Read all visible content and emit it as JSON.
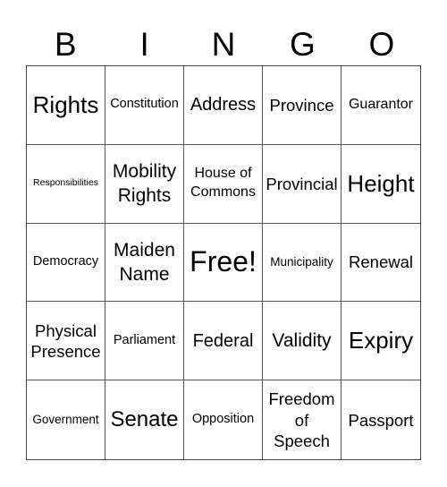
{
  "header": [
    "B",
    "I",
    "N",
    "G",
    "O"
  ],
  "cells": [
    [
      "Rights",
      "Constitution",
      "Address",
      "Province",
      "Guarantor"
    ],
    [
      "Responsibilities",
      "Mobility Rights",
      "House of Commons",
      "Provincial",
      "Height"
    ],
    [
      "Democracy",
      "Maiden Name",
      "Free!",
      "Municipality",
      "Renewal"
    ],
    [
      "Physical Presence",
      "Parliament",
      "Federal",
      "Validity",
      "Expiry"
    ],
    [
      "Government",
      "Senate",
      "Opposition",
      "Freedom of Speech",
      "Passport"
    ]
  ]
}
